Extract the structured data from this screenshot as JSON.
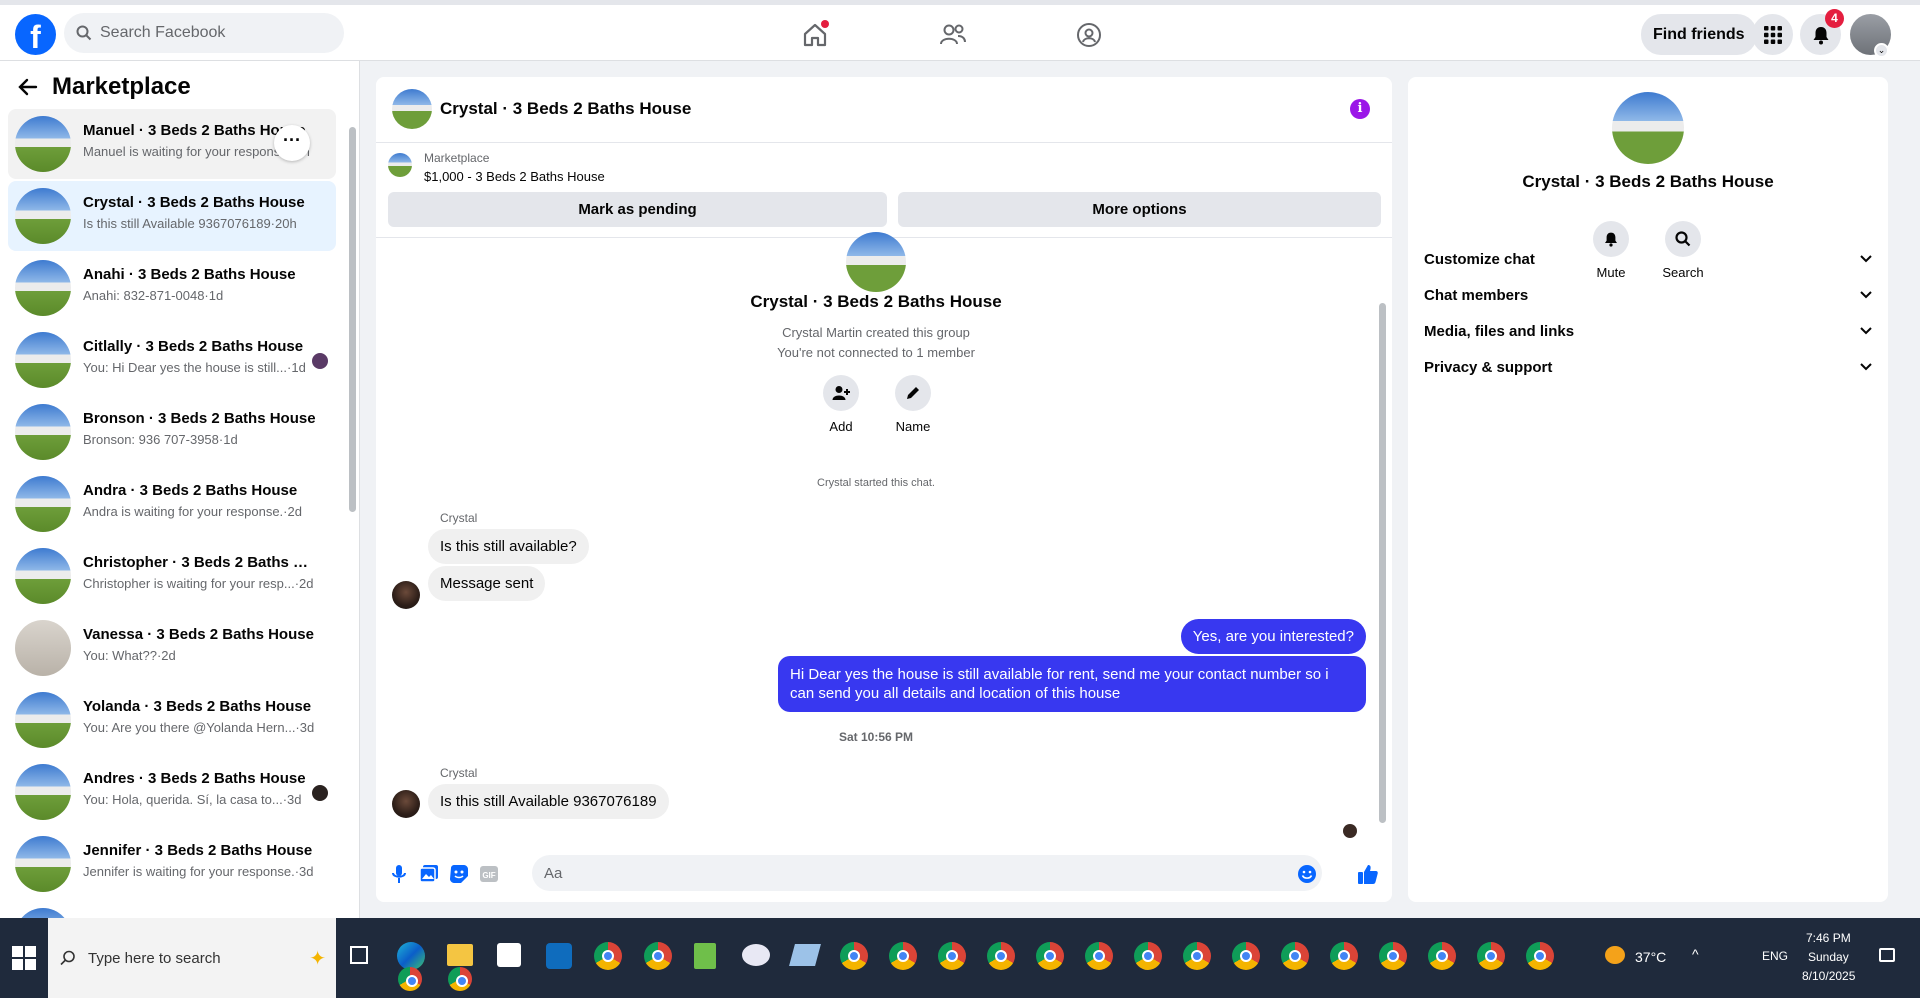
{
  "topbar": {
    "search_placeholder": "Search Facebook",
    "find_friends_label": "Find friends",
    "notification_count": "4",
    "accent_color": "#0866ff"
  },
  "sidebar": {
    "title": "Marketplace",
    "conversations": [
      {
        "title": "Manuel · 3 Beds 2 Baths House",
        "subtitle": "Manuel is waiting for your response.·1h"
      },
      {
        "title": "Crystal · 3 Beds 2 Baths House",
        "subtitle": "Is this still Available 9367076189·20h"
      },
      {
        "title": "Anahi · 3 Beds 2 Baths House",
        "subtitle": "Anahi: 832-871-0048·1d"
      },
      {
        "title": "Citlally · 3 Beds 2 Baths House",
        "subtitle": "You: Hi Dear yes the house is still...·1d"
      },
      {
        "title": "Bronson · 3 Beds 2 Baths House",
        "subtitle": "Bronson: 936 707-3958·1d"
      },
      {
        "title": "Andra · 3 Beds 2 Baths House",
        "subtitle": "Andra is waiting for your response.·2d"
      },
      {
        "title": "Christopher · 3 Beds 2 Baths Ho...",
        "subtitle": "Christopher is waiting for your resp...·2d"
      },
      {
        "title": "Vanessa · 3 Beds 2 Baths House",
        "subtitle": "You: What??·2d"
      },
      {
        "title": "Yolanda · 3 Beds 2 Baths House",
        "subtitle": "You: Are you there @Yolanda Hern...·3d"
      },
      {
        "title": "Andres · 3 Beds 2 Baths House",
        "subtitle": "You: Hola, querida. Sí, la casa to...·3d"
      },
      {
        "title": "Jennifer · 3 Beds 2 Baths House",
        "subtitle": "Jennifer is waiting for your response.·3d"
      }
    ]
  },
  "chat": {
    "header_name": "Crystal · 3 Beds 2 Baths House",
    "listing_label": "Marketplace",
    "listing_price": "$1,000 - 3 Beds 2 Baths House",
    "mark_pending_label": "Mark as pending",
    "more_options_label": "More options",
    "intro_name": "Crystal · 3 Beds 2 Baths House",
    "intro_created": "Crystal Martin created this group",
    "intro_connected": "You're not connected to 1 member",
    "add_label": "Add",
    "name_label": "Name",
    "started_text": "Crystal started this chat.",
    "messages": [
      {
        "sender": "Crystal",
        "text": "Is this still available?"
      },
      {
        "text": "Message sent"
      },
      {
        "text": "Yes, are you interested?"
      },
      {
        "text": "Hi Dear yes the house is still available for rent, send me your contact number so i can send you all details and location of this house"
      },
      {
        "sender": "Crystal",
        "text": "Is this still Available 9367076189"
      }
    ],
    "timestamp": "Sat 10:56 PM",
    "composer_placeholder": "Aa",
    "outgoing_color": "#3838f0"
  },
  "details": {
    "name": "Crystal · 3 Beds 2 Baths House",
    "mute_label": "Mute",
    "search_label": "Search",
    "sections": [
      "Customize chat",
      "Chat members",
      "Media, files and links",
      "Privacy & support"
    ]
  },
  "taskbar": {
    "search_placeholder": "Type here to search",
    "temperature": "37°C",
    "language": "ENG",
    "time": "7:46 PM",
    "day": "Sunday",
    "date": "8/10/2025"
  }
}
